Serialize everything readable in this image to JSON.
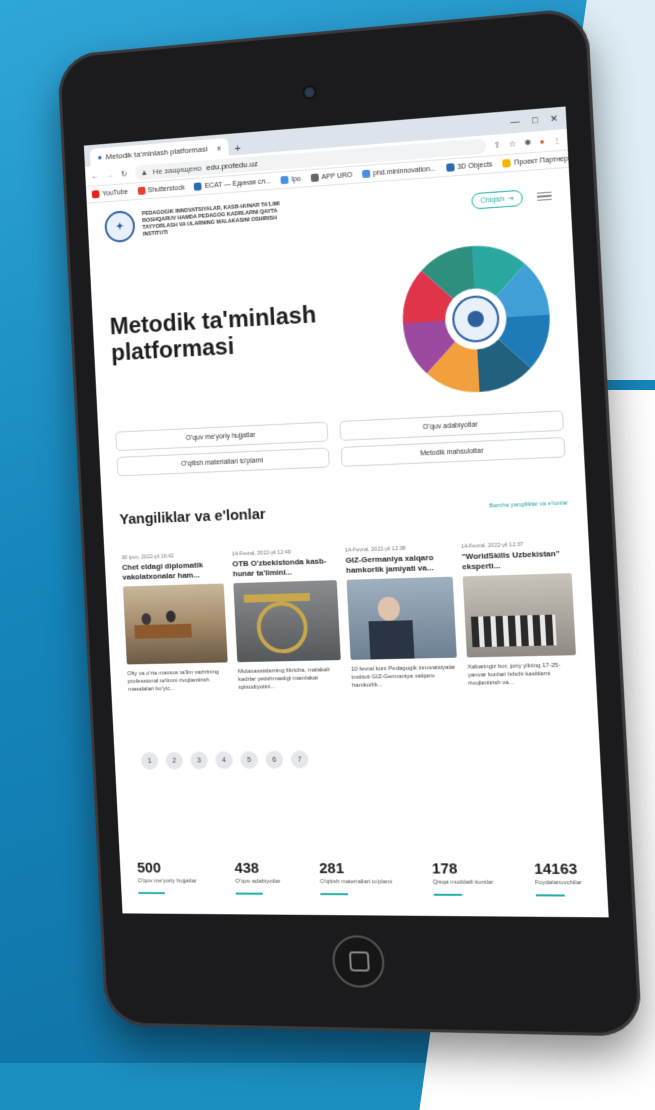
{
  "browser": {
    "tab_title": "Metodik ta'minlash platformasi",
    "tab_close": "x",
    "new_tab": "+",
    "security_label": "Не защищено",
    "url": "edu.profedu.uz",
    "window_controls": [
      "—",
      "□",
      "✕"
    ]
  },
  "bookmarks": [
    {
      "label": "YouTube",
      "color": "#e62117"
    },
    {
      "label": "Shutterstock",
      "color": "#e8412c"
    },
    {
      "label": "ECAT — Единая сл...",
      "color": "#2b6cb0"
    },
    {
      "label": "Ipo",
      "color": "#4a90e2"
    },
    {
      "label": "APP URO",
      "color": "#666666"
    },
    {
      "label": "phd.mininnovation...",
      "color": "#4a90e2"
    },
    {
      "label": "3D Objects",
      "color": "#2b6cb0"
    },
    {
      "label": "Проект Партнер...",
      "color": "#f2b705"
    }
  ],
  "site": {
    "institute_name": "PEDAGOGIK INNOVATSIYALAR, KASB-HUNAR TA'LIMI BOSHQARUV HAMDA PEDAGOG KADRLARNI QAYTA TAYYORLASH VA ULARNING MALAKASINI OSHIRISH INSTITUTI",
    "login_label": "Chiqish",
    "hero_title": "Metodik ta'minlash platformasi",
    "doc_buttons": [
      "O'quv me'yoriy hujjatlar",
      "O'quv adabiyotlar",
      "O'qitish materiallari to'plami",
      "Metodik mahsulotlar"
    ],
    "news_heading": "Yangiliklar va e'lonlar",
    "all_news_link": "Barcha yangiliklar va e'lonlar",
    "news": [
      {
        "date": "30 iyun, 2022-yil 16:42",
        "title": "Chet eldagi diplomatik vakolatxonalar ham...",
        "desc": "Oliy va o'rta maxsus ta'lim vazirining professional ta'limni rivojlantirish masalalari bo'yic..."
      },
      {
        "date": "14-Fevral, 2022-yil 12:49",
        "title": "OTB O'zbekistonda kasb-hunar ta'limini...",
        "desc": "Mutaxassislarning fikricha, malakali kadrlar yetishmasligi mamlakat iqtisodiyotini..."
      },
      {
        "date": "14-Fevral, 2022-yil 12:38",
        "title": "GIZ-Germaniya xalqaro hamkorlik jamiyati va...",
        "desc": "10 fevral kuni Pedagogik innovatsiyalar instituti GIZ-Germaniya xalqaro hamkorlik..."
      },
      {
        "date": "14-Fevral, 2022-yil 12:37",
        "title": "\"WorldSkills Uzbekistan\" eksperti...",
        "desc": "Xabaringiz bor, joriy yilning 17-25-yanvar kunlari Ishchi kasblarni rivojlantirish va..."
      }
    ],
    "pages": [
      "1",
      "2",
      "3",
      "4",
      "5",
      "6",
      "7"
    ],
    "stats": [
      {
        "value": "500",
        "label": "O'quv me'yoriy hujjatlar"
      },
      {
        "value": "438",
        "label": "O'quv adabiyotlar"
      },
      {
        "value": "281",
        "label": "O'qitish materiallari to'plami"
      },
      {
        "value": "178",
        "label": "Qisqa muddatli kurslar"
      },
      {
        "value": "14163",
        "label": "Foydalanuvchilar"
      }
    ]
  },
  "colors": {
    "accent": "#22b1a6",
    "background": "#1a8fc0"
  }
}
